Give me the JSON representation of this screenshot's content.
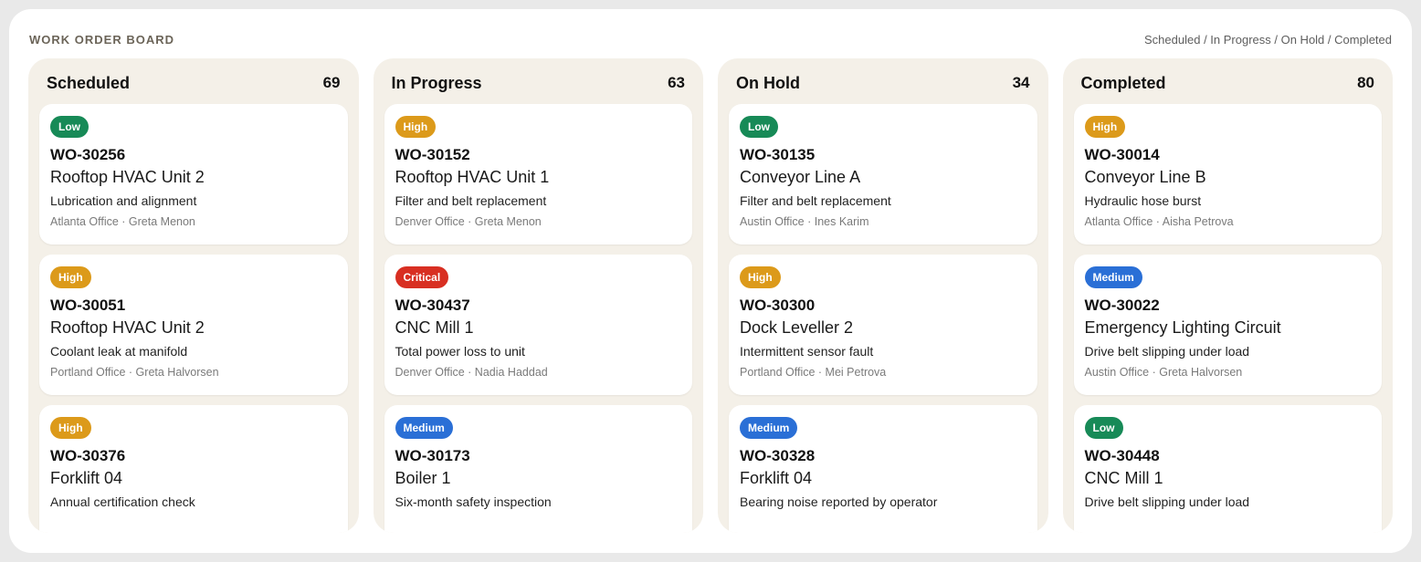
{
  "board": {
    "title": "WORK ORDER BOARD",
    "legend": "Scheduled / In Progress / On Hold / Completed"
  },
  "priority_colors": {
    "Low": "#178a57",
    "High": "#dc9a1a",
    "Critical": "#d82f22",
    "Medium": "#2a6fd6"
  },
  "columns": [
    {
      "name": "Scheduled",
      "count": "69",
      "cards": [
        {
          "priority": "Low",
          "id": "WO-30256",
          "asset": "Rooftop HVAC Unit 2",
          "desc": "Lubrication and alignment",
          "meta": "Atlanta Office · Greta Menon"
        },
        {
          "priority": "High",
          "id": "WO-30051",
          "asset": "Rooftop HVAC Unit 2",
          "desc": "Coolant leak at manifold",
          "meta": "Portland Office · Greta Halvorsen"
        },
        {
          "priority": "High",
          "id": "WO-30376",
          "asset": "Forklift 04",
          "desc": "Annual certification check",
          "meta": ""
        }
      ]
    },
    {
      "name": "In Progress",
      "count": "63",
      "cards": [
        {
          "priority": "High",
          "id": "WO-30152",
          "asset": "Rooftop HVAC Unit 1",
          "desc": "Filter and belt replacement",
          "meta": "Denver Office · Greta Menon"
        },
        {
          "priority": "Critical",
          "id": "WO-30437",
          "asset": "CNC Mill 1",
          "desc": "Total power loss to unit",
          "meta": "Denver Office · Nadia Haddad"
        },
        {
          "priority": "Medium",
          "id": "WO-30173",
          "asset": "Boiler 1",
          "desc": "Six-month safety inspection",
          "meta": ""
        }
      ]
    },
    {
      "name": "On Hold",
      "count": "34",
      "cards": [
        {
          "priority": "Low",
          "id": "WO-30135",
          "asset": "Conveyor Line A",
          "desc": "Filter and belt replacement",
          "meta": "Austin Office · Ines Karim"
        },
        {
          "priority": "High",
          "id": "WO-30300",
          "asset": "Dock Leveller 2",
          "desc": "Intermittent sensor fault",
          "meta": "Portland Office · Mei Petrova"
        },
        {
          "priority": "Medium",
          "id": "WO-30328",
          "asset": "Forklift 04",
          "desc": "Bearing noise reported by operator",
          "meta": ""
        }
      ]
    },
    {
      "name": "Completed",
      "count": "80",
      "cards": [
        {
          "priority": "High",
          "id": "WO-30014",
          "asset": "Conveyor Line B",
          "desc": "Hydraulic hose burst",
          "meta": "Atlanta Office · Aisha Petrova"
        },
        {
          "priority": "Medium",
          "id": "WO-30022",
          "asset": "Emergency Lighting Circuit",
          "desc": "Drive belt slipping under load",
          "meta": "Austin Office · Greta Halvorsen"
        },
        {
          "priority": "Low",
          "id": "WO-30448",
          "asset": "CNC Mill 1",
          "desc": "Drive belt slipping under load",
          "meta": ""
        }
      ]
    }
  ]
}
